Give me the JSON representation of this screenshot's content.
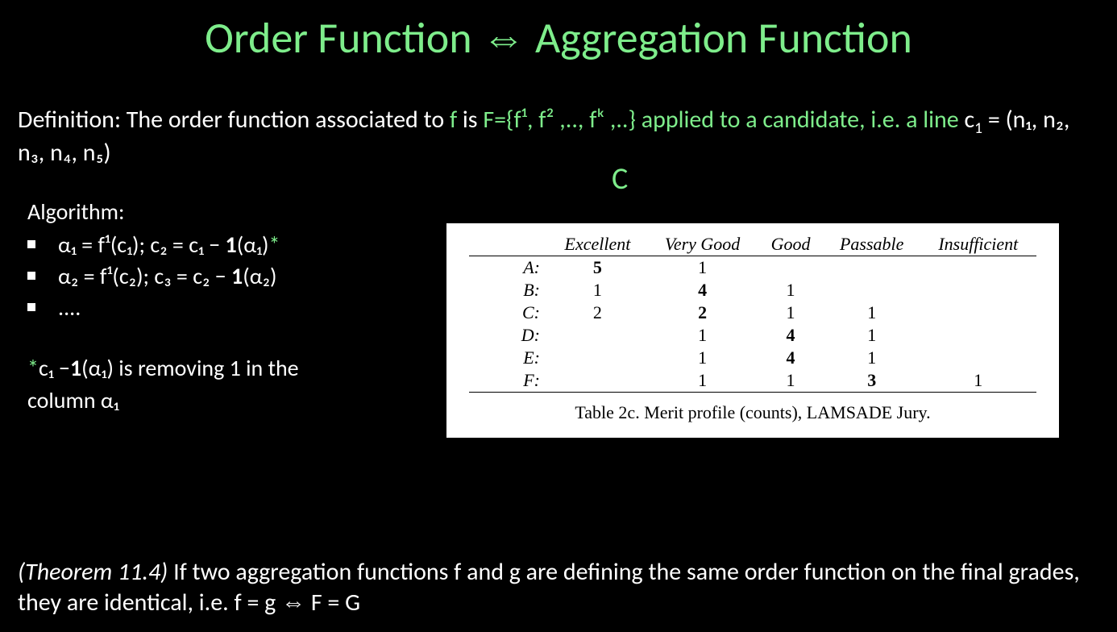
{
  "title_part1": "Order Function ",
  "title_symbol": "⇔",
  "title_part2": " Aggregation Function",
  "definition": {
    "pre": "Definition: The order function associated to ",
    "f": "f",
    "mid1": " is ",
    "F_expr": "F={f¹, f² ,.., fᵏ ,..}",
    "mid2": " applied to a candidate, i.e. a ",
    "line_word": "line",
    "line_expr_c1": " c",
    "line_expr_rest": " = (n₁, n₂, n₃, n₄, n₅)"
  },
  "algo": {
    "header": "Algorithm:",
    "items": [
      {
        "plain_pre": "α₁ = f¹(c₁); c₂ = c₁ − ",
        "bold": "1",
        "plain_post": "(α₁)",
        "star": "*"
      },
      {
        "plain_pre": "α₂ = f¹(c₂); c₃ = c₂ − ",
        "bold": "1",
        "plain_post": "(α₂)",
        "star": ""
      },
      {
        "plain_pre": "....",
        "bold": "",
        "plain_post": "",
        "star": ""
      }
    ],
    "note_star": "*",
    "note_line1_a": "c₁ −",
    "note_line1_bold": "1",
    "note_line1_b": "(α₁) is removing 1 in the",
    "note_line2": "column α₁"
  },
  "c_label": "C",
  "table": {
    "headers": [
      "",
      "Excellent",
      "Very Good",
      "Good",
      "Passable",
      "Insufficient"
    ],
    "rows": [
      {
        "label": "A:",
        "vals": [
          "5",
          "1",
          "",
          "",
          ""
        ],
        "bold_col": 0
      },
      {
        "label": "B:",
        "vals": [
          "1",
          "4",
          "1",
          "",
          ""
        ],
        "bold_col": 1
      },
      {
        "label": "C:",
        "vals": [
          "2",
          "2",
          "1",
          "1",
          ""
        ],
        "bold_col": 1
      },
      {
        "label": "D:",
        "vals": [
          "",
          "1",
          "4",
          "1",
          ""
        ],
        "bold_col": 2
      },
      {
        "label": "E:",
        "vals": [
          "",
          "1",
          "4",
          "1",
          ""
        ],
        "bold_col": 2
      },
      {
        "label": "F:",
        "vals": [
          "",
          "1",
          "1",
          "3",
          "1"
        ],
        "bold_col": 3
      }
    ],
    "caption": "Table 2c. Merit profile (counts), LAMSADE Jury."
  },
  "theorem": {
    "lead": "(Theorem 11.4)",
    "body": " If two aggregation functions f and g are defining the same order function on the final grades, they are identical, i.e. f = g ⇔ F = G"
  }
}
